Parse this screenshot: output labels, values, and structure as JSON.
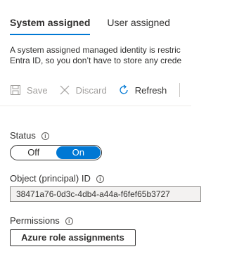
{
  "tabs": [
    {
      "label": "System assigned",
      "active": true
    },
    {
      "label": "User assigned",
      "active": false
    }
  ],
  "description": {
    "line1": "A system assigned managed identity is restric",
    "line2": "Entra ID, so you don’t have to store any crede"
  },
  "toolbar": {
    "save_label": "Save",
    "discard_label": "Discard",
    "refresh_label": "Refresh"
  },
  "status": {
    "label": "Status",
    "off_label": "Off",
    "on_label": "On",
    "selected": "On"
  },
  "object_id": {
    "label": "Object (principal) ID",
    "value": "38471a76-0d3c-4db4-a44a-f6fef65b3727"
  },
  "permissions": {
    "label": "Permissions",
    "button_label": "Azure role assignments"
  },
  "colors": {
    "accent": "#0078d4",
    "text": "#323130",
    "disabled": "#a19f9d"
  },
  "icons": {
    "save": "save-icon",
    "discard": "close-icon",
    "refresh": "refresh-icon",
    "info": "info-icon"
  }
}
